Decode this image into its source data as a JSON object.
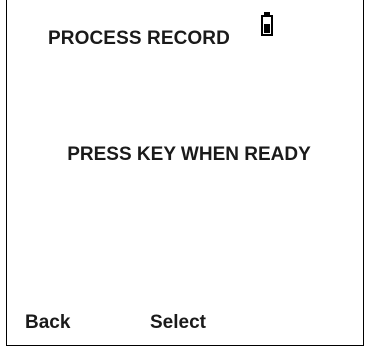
{
  "screen": {
    "title": "PROCESS RECORD",
    "prompt": "PRESS KEY WHEN READY"
  },
  "status": {
    "battery_icon": "battery-icon",
    "battery_level": 0.6
  },
  "softkeys": {
    "left_label": "Back",
    "right_label": "Select"
  }
}
